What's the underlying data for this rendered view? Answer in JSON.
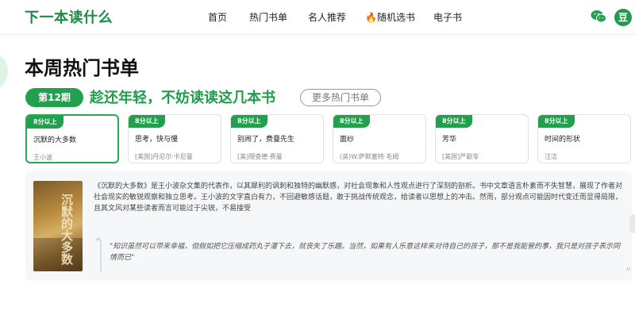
{
  "header": {
    "logo": "下一本读什么",
    "nav": [
      {
        "label": "首页"
      },
      {
        "label": "热门书单"
      },
      {
        "label": "名人推荐"
      },
      {
        "label": "🔥随机选书"
      },
      {
        "label": "电子书"
      }
    ],
    "avatar_letter": "豆",
    "wechat_icon": "wechat-icon"
  },
  "main": {
    "title": "本周热门书单",
    "issue_badge": "第12期",
    "headline": "趁还年轻，不妨读读这几本书",
    "more_button": "更多热门书单",
    "cards": [
      {
        "tag": "8分以上",
        "title": "沉默的大多数",
        "author": "王小波"
      },
      {
        "tag": "8分以上",
        "title": "思考，快与慢",
        "author": "[美国]丹尼尔·卡尼曼"
      },
      {
        "tag": "8分以上",
        "title": "别闹了，费曼先生",
        "author": "[美]理查德·费曼"
      },
      {
        "tag": "8分以上",
        "title": "面纱",
        "author": "(英)W.萨默塞特·毛姆"
      },
      {
        "tag": "8分以上",
        "title": "芳华",
        "author": "[美国]严歌苓"
      },
      {
        "tag": "8分以上",
        "title": "时间的形状",
        "author": "汪洁"
      }
    ],
    "detail": {
      "cover_text": "沉默的大多数",
      "description": "《沉默的大多数》是王小波杂文集的代表作，以其犀利的讽刺和独特的幽默感，对社会现象和人性观点进行了深刻的剖析。书中文章语言朴素而不失智慧，展现了作者对社会现实的敏锐观察和独立思考。王小波的文字直白有力，不回避敏感话题，敢于挑战传统观念，给读者以思想上的冲击。然而，部分观点可能因时代变迁而显得局限，且其文风对某些读者而言可能过于尖锐，不易接受",
      "quote": "\"知识虽然可以带来幸福，但假如把它压缩成药丸子灌下去，就丧失了乐趣。当然，如果有人乐意这样来对待自己的孩子，那不是我能管的事，我只是对孩子表示同情而已\""
    }
  },
  "colors": {
    "brand": "#1f9d4a",
    "badge": "#22a04e"
  }
}
